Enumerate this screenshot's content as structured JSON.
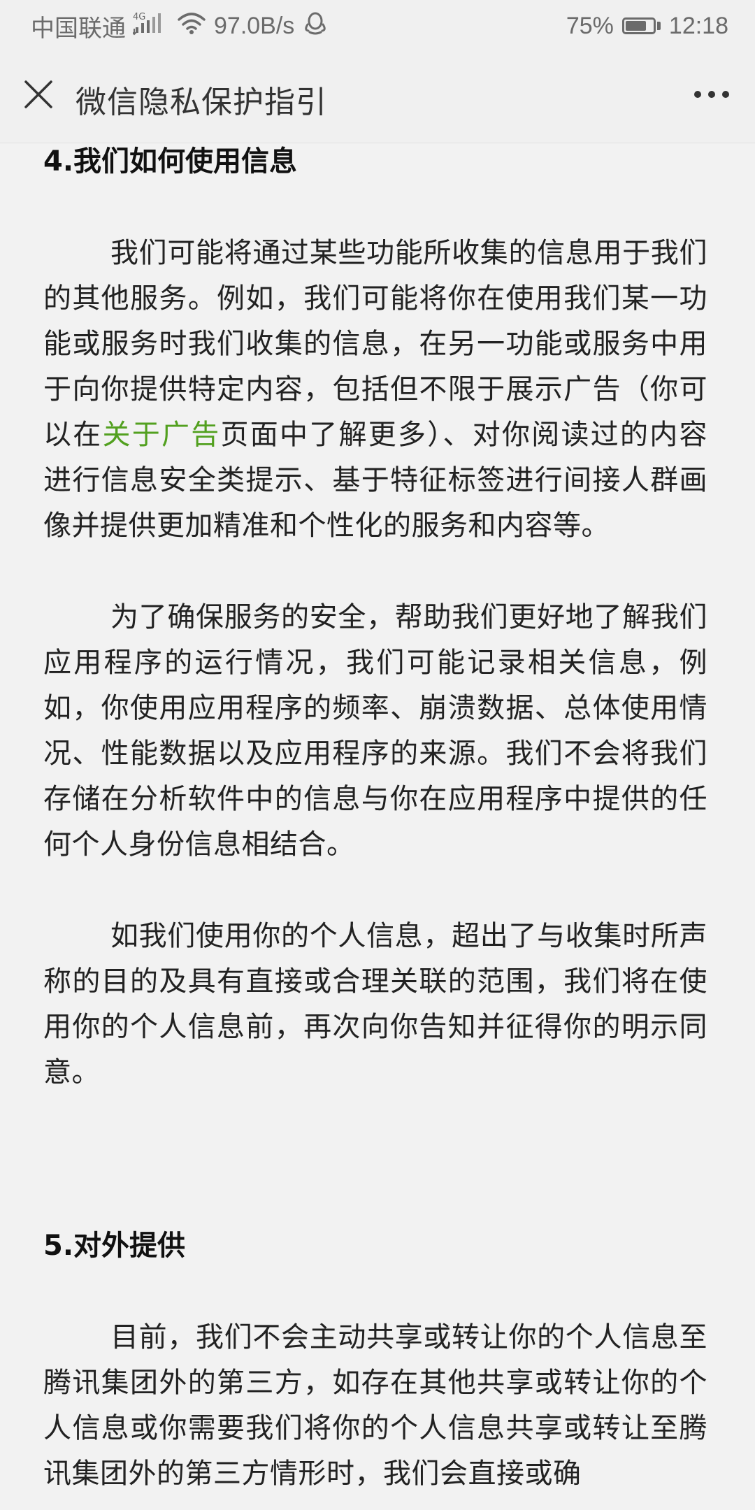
{
  "status_bar": {
    "carrier": "中国联通",
    "network_badge": "4G",
    "speed": "97.0B/s",
    "battery_percent_text": "75%",
    "battery_level": 0.75,
    "time": "12:18",
    "icons": [
      "signal-icon",
      "wifi-icon",
      "qq-penguin-icon",
      "battery-icon"
    ]
  },
  "navbar": {
    "title": "微信隐私保护指引",
    "close_icon": "close-icon",
    "more_icon": "more-dots-icon"
  },
  "sections": [
    {
      "heading": "4.我们如何使用信息",
      "paragraphs": [
        {
          "before_link": "我们可能将通过某些功能所收集的信息用于我们的其他服务。例如，我们可能将你在使用我们某一功能或服务时我们收集的信息，在另一功能或服务中用于向你提供特定内容，包括但不限于展示广告（你可以在",
          "link_text": "关于广告",
          "after_link": "页面中了解更多）、对你阅读过的内容进行信息安全类提示、基于特征标签进行间接人群画像并提供更加精准和个性化的服务和内容等。"
        },
        {
          "text": "为了确保服务的安全，帮助我们更好地了解我们应用程序的运行情况，我们可能记录相关信息，例如，你使用应用程序的频率、崩溃数据、总体使用情况、性能数据以及应用程序的来源。我们不会将我们存储在分析软件中的信息与你在应用程序中提供的任何个人身份信息相结合。"
        },
        {
          "text": "如我们使用你的个人信息，超出了与收集时所声称的目的及具有直接或合理关联的范围，我们将在使用你的个人信息前，再次向你告知并征得你的明示同意。"
        }
      ]
    },
    {
      "heading": "5.对外提供",
      "paragraphs": [
        {
          "text": "目前，我们不会主动共享或转让你的个人信息至腾讯集团外的第三方，如存在其他共享或转让你的个人信息或你需要我们将你的个人信息共享或转让至腾讯集团外的第三方情形时，我们会直接或确"
        }
      ]
    }
  ],
  "colors": {
    "background": "#f2f2f2",
    "link": "#52a01f",
    "text": "#222222",
    "statusbar_text": "#6b6b6b"
  }
}
